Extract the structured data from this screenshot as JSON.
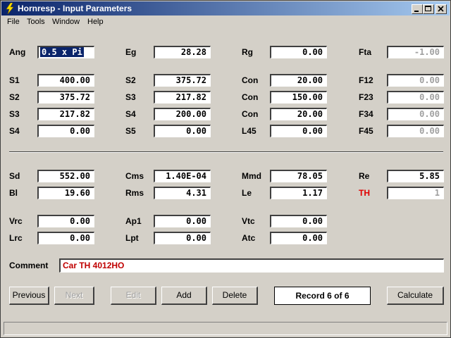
{
  "window": {
    "title": "Hornresp - Input Parameters"
  },
  "menu": [
    "File",
    "Tools",
    "Window",
    "Help"
  ],
  "rows": [
    {
      "key": "ang",
      "label": "Ang",
      "value": "0.5 x Pi",
      "selected": true
    },
    {
      "key": "eg",
      "label": "Eg",
      "value": "28.28"
    },
    {
      "key": "rg",
      "label": "Rg",
      "value": "0.00"
    },
    {
      "key": "fta",
      "label": "Fta",
      "value": "-1.00",
      "grey": true
    },
    {
      "key": "s1",
      "label": "S1",
      "value": "400.00"
    },
    {
      "key": "s2a",
      "label": "S2",
      "value": "375.72"
    },
    {
      "key": "con1",
      "label": "Con",
      "value": "20.00"
    },
    {
      "key": "f12",
      "label": "F12",
      "value": "0.00",
      "grey": true
    },
    {
      "key": "s2b",
      "label": "S2",
      "value": "375.72"
    },
    {
      "key": "s3a",
      "label": "S3",
      "value": "217.82"
    },
    {
      "key": "con2",
      "label": "Con",
      "value": "150.00"
    },
    {
      "key": "f23",
      "label": "F23",
      "value": "0.00",
      "grey": true
    },
    {
      "key": "s3b",
      "label": "S3",
      "value": "217.82"
    },
    {
      "key": "s4a",
      "label": "S4",
      "value": "200.00"
    },
    {
      "key": "con3",
      "label": "Con",
      "value": "20.00"
    },
    {
      "key": "f34",
      "label": "F34",
      "value": "0.00",
      "grey": true
    },
    {
      "key": "s4b",
      "label": "S4",
      "value": "0.00"
    },
    {
      "key": "s5",
      "label": "S5",
      "value": "0.00"
    },
    {
      "key": "l45",
      "label": "L45",
      "value": "0.00"
    },
    {
      "key": "f45",
      "label": "F45",
      "value": "0.00",
      "grey": true
    },
    {
      "key": "sd",
      "label": "Sd",
      "value": "552.00"
    },
    {
      "key": "cms",
      "label": "Cms",
      "value": "1.40E-04"
    },
    {
      "key": "mmd",
      "label": "Mmd",
      "value": "78.05"
    },
    {
      "key": "re",
      "label": "Re",
      "value": "5.85"
    },
    {
      "key": "bl",
      "label": "Bl",
      "value": "19.60"
    },
    {
      "key": "rms",
      "label": "Rms",
      "value": "4.31"
    },
    {
      "key": "le",
      "label": "Le",
      "value": "1.17"
    },
    {
      "key": "th",
      "label": "TH",
      "value": "1",
      "grey": true,
      "red": true
    },
    {
      "key": "vrc",
      "label": "Vrc",
      "value": "0.00"
    },
    {
      "key": "ap1",
      "label": "Ap1",
      "value": "0.00"
    },
    {
      "key": "vtc",
      "label": "Vtc",
      "value": "0.00"
    },
    {
      "key": "lrc",
      "label": "Lrc",
      "value": "0.00"
    },
    {
      "key": "lpt",
      "label": "Lpt",
      "value": "0.00"
    },
    {
      "key": "atc",
      "label": "Atc",
      "value": "0.00"
    }
  ],
  "comment": {
    "label": "Comment",
    "value": "Car TH 4012HO"
  },
  "buttons": {
    "previous": "Previous",
    "next": "Next",
    "edit": "Edit",
    "add": "Add",
    "delete": "Delete",
    "calculate": "Calculate"
  },
  "record": "Record 6 of 6",
  "colors": {
    "title_start": "#0a246a",
    "title_end": "#a6caf0",
    "face": "#d4d0c8",
    "comment_text": "#c00000",
    "th_label": "#e00000"
  }
}
